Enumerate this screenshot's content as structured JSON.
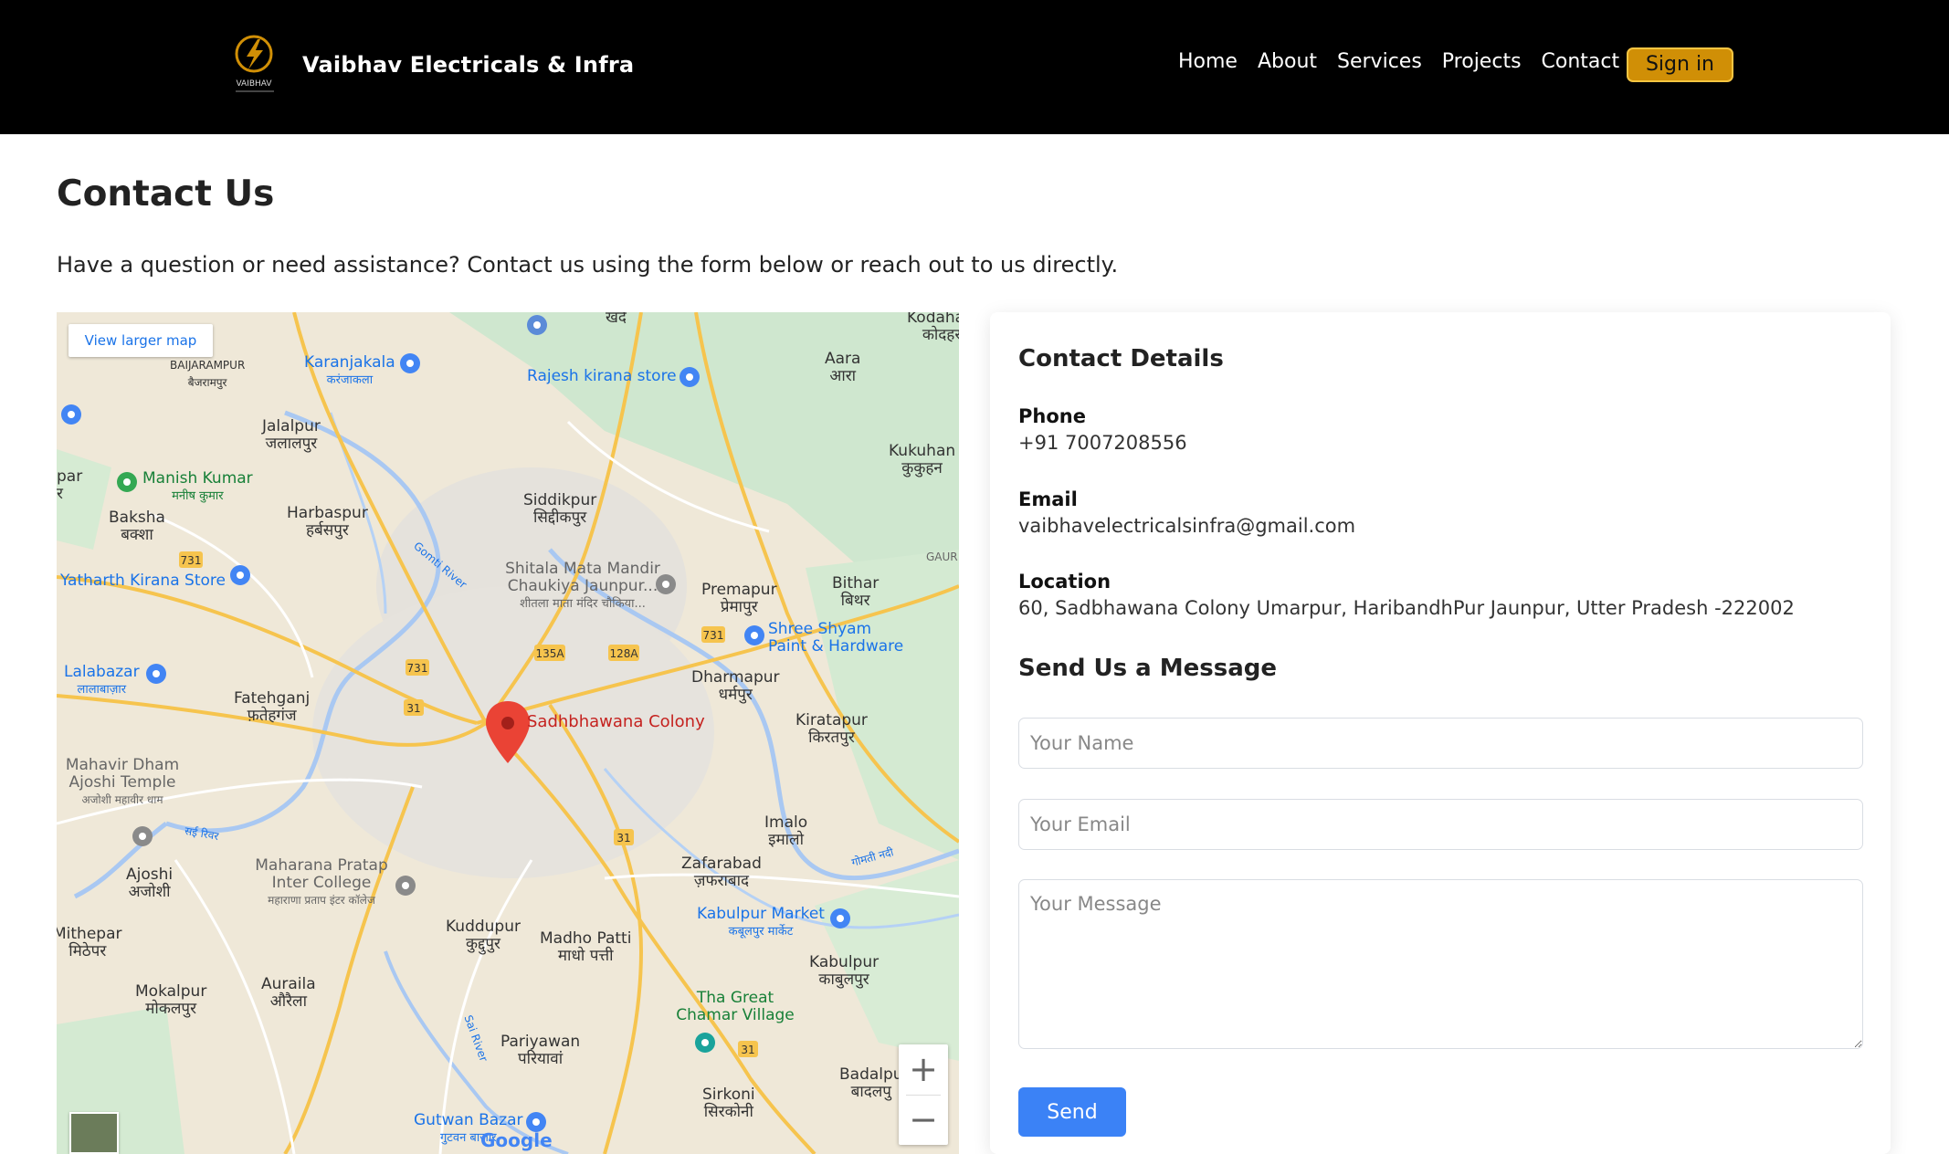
{
  "header": {
    "logo_text": "VAIBHAV",
    "brand": "Vaibhav Electricals & Infra",
    "nav": [
      "Home",
      "About",
      "Services",
      "Projects",
      "Contact"
    ],
    "signin_label": "Sign in",
    "accent_color": "#d08f06"
  },
  "main": {
    "title": "Contact Us",
    "intro": "Have a question or need assistance? Contact us using the form below or reach out to us directly."
  },
  "map": {
    "view_larger": "View larger map",
    "marker_label": "Sadhbhawana Colony",
    "zoom_in": "+",
    "zoom_out": "−",
    "provider_logo": "Google",
    "places": [
      {
        "name": "Kodahara",
        "sub": "कोदहरा"
      },
      {
        "name": "खर्द",
        "sub": ""
      },
      {
        "name": "BAIJARAMPUR",
        "sub": "बैजरामपुर"
      },
      {
        "name": "Karanjakala",
        "sub": "करंजाकला"
      },
      {
        "name": "Rajesh kirana store",
        "sub": ""
      },
      {
        "name": "Aara",
        "sub": "आरा"
      },
      {
        "name": "Jalalpur",
        "sub": "जलालपुर"
      },
      {
        "name": "Kukuhan",
        "sub": "कुकुहन"
      },
      {
        "name": "Manish Kumar",
        "sub": "मनीष कुमार"
      },
      {
        "name": "Baksha",
        "sub": "बक्शा"
      },
      {
        "name": "Harbaspur",
        "sub": "हर्बसपुर"
      },
      {
        "name": "Siddikpur",
        "sub": "सिद्दीकपुर"
      },
      {
        "name": "Yatharth Kirana Store",
        "sub": ""
      },
      {
        "name": "Shitala Mata Mandir Chaukiya Jaunpur...",
        "sub": "शीतला माता मंदिर चौकिया..."
      },
      {
        "name": "Premapur",
        "sub": "प्रेमापुर"
      },
      {
        "name": "Bithar",
        "sub": "बिथर"
      },
      {
        "name": "Shree Shyam Paint & Hardware",
        "sub": ""
      },
      {
        "name": "Lalabazar",
        "sub": "लालाबाज़ार"
      },
      {
        "name": "Dharmapur",
        "sub": "धर्मपुर"
      },
      {
        "name": "Fatehganj",
        "sub": "फ़तेहगंज"
      },
      {
        "name": "Kiratapur",
        "sub": "किरतपुर"
      },
      {
        "name": "Mahavir Dham Ajoshi Temple",
        "sub": "अजोशी महावीर धाम"
      },
      {
        "name": "Imalo",
        "sub": "इमालो"
      },
      {
        "name": "Ajoshi",
        "sub": "अजोशी"
      },
      {
        "name": "Maharana Pratap Inter College",
        "sub": "महाराणा प्रताप इंटर कॉलेज"
      },
      {
        "name": "Zafarabad",
        "sub": "ज़फराबाद"
      },
      {
        "name": "Kabulpur Market",
        "sub": "कबूलपुर मार्केट"
      },
      {
        "name": "Mithepar",
        "sub": "मिठेपर"
      },
      {
        "name": "Kuddupur",
        "sub": "कुद्दुपुर"
      },
      {
        "name": "Madho Patti",
        "sub": "माधो पत्ती"
      },
      {
        "name": "Kabulpur",
        "sub": "काबुलपुर"
      },
      {
        "name": "Mokalpur",
        "sub": "मोकलपुर"
      },
      {
        "name": "Auraila",
        "sub": "औरैला"
      },
      {
        "name": "Tha Great Chamar Village",
        "sub": ""
      },
      {
        "name": "Pariyawan",
        "sub": "परियावां"
      },
      {
        "name": "Badalpu",
        "sub": "बादलपु"
      },
      {
        "name": "Sirkoni",
        "sub": "सिरकोनी"
      },
      {
        "name": "Gutwan Bazar",
        "sub": "गुटवन बाजार"
      },
      {
        "name": "Gomti River",
        "sub": ""
      },
      {
        "name": "Sai River",
        "sub": ""
      },
      {
        "name": "सई रिवर",
        "sub": ""
      },
      {
        "name": "गोमती नदी",
        "sub": ""
      },
      {
        "name": "GAUR",
        "sub": ""
      },
      {
        "name": "par",
        "sub": "र"
      }
    ],
    "route_shields": [
      "731",
      "135A",
      "128A",
      "731",
      "731",
      "31",
      "31",
      "31"
    ]
  },
  "contact": {
    "details_heading": "Contact Details",
    "phone_label": "Phone",
    "phone": "+91 7007208556",
    "email_label": "Email",
    "email": "vaibhavelectricalsinfra@gmail.com",
    "location_label": "Location",
    "location": "60, Sadbhawana Colony Umarpur, HaribandhPur Jaunpur, Utter Pradesh -222002",
    "form_heading": "Send Us a Message",
    "name_placeholder": "Your Name",
    "email_placeholder": "Your Email",
    "message_placeholder": "Your Message",
    "send_label": "Send",
    "button_color": "#3b82f6"
  }
}
